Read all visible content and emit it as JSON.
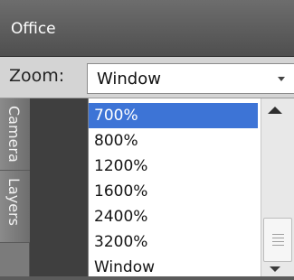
{
  "window": {
    "title": "Office"
  },
  "zoom": {
    "label": "Zoom:",
    "selected_value": "Window",
    "options": [
      {
        "label": "700%",
        "selected": true
      },
      {
        "label": "800%",
        "selected": false
      },
      {
        "label": "1200%",
        "selected": false
      },
      {
        "label": "1600%",
        "selected": false
      },
      {
        "label": "2400%",
        "selected": false
      },
      {
        "label": "3200%",
        "selected": false
      },
      {
        "label": "Window",
        "selected": false
      }
    ]
  },
  "side_tabs": [
    {
      "label": "Camera"
    },
    {
      "label": "Layers"
    }
  ],
  "colors": {
    "selection": "#3d74d6",
    "panel_dark": "#3f3f3f",
    "tab_gray": "#7b7b7b",
    "zoom_bar": "#d4d4d4"
  }
}
